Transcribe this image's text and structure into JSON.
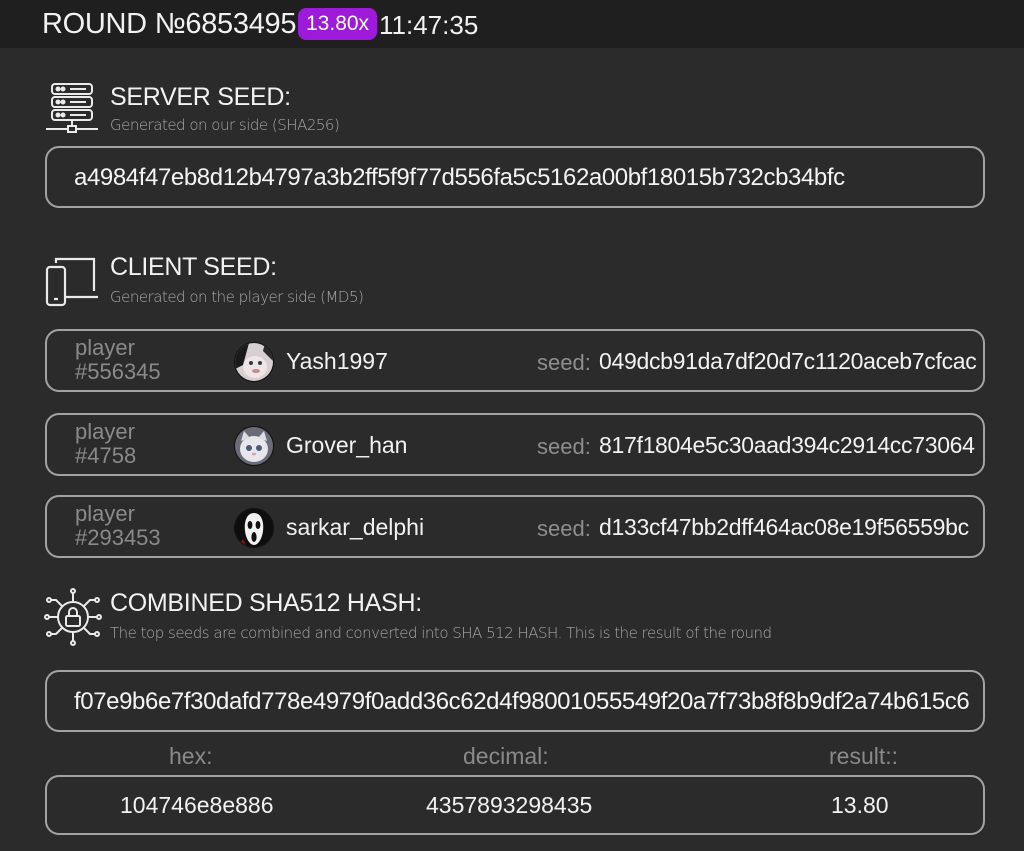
{
  "header": {
    "round_label": "ROUND №6853495",
    "multiplier": "13.80x",
    "time": "11:47:35",
    "multiplier_color": "#9d1bd8"
  },
  "server_seed": {
    "title": "SERVER SEED:",
    "subtitle": "Generated on our side (SHA256)",
    "icon": "server-icon",
    "value": "a4984f47eb8d12b4797a3b2ff5f9f77d556fa5c5162a00bf18015b732cb34bfc"
  },
  "client_seed": {
    "title": "CLIENT SEED:",
    "subtitle": "Generated on the player side (MD5)",
    "icon": "devices-icon",
    "players": [
      {
        "label": "player",
        "number": "#556345",
        "name": "Yash1997",
        "seed_label": "seed:",
        "seed": "049dcb91da7df20d7c1120aceb7cfcac"
      },
      {
        "label": "player",
        "number": "#4758",
        "name": "Grover_han",
        "seed_label": "seed:",
        "seed": "817f1804e5c30aad394c2914cc73064"
      },
      {
        "label": "player",
        "number": "#293453",
        "name": "sarkar_delphi",
        "seed_label": "seed:",
        "seed": "d133cf47bb2dff464ac08e19f56559bc"
      }
    ]
  },
  "combined": {
    "title": "COMBINED SHA512 HASH:",
    "subtitle": "The top seeds are combined and converted into SHA 512 HASH. This is the result of the round",
    "icon": "lock-circuit-icon",
    "value": "f07e9b6e7f30dafd778e4979f0add36c62d4f98001055549f20a7f73b8f8b9df2a74b615c6"
  },
  "result": {
    "hex_label": "hex:",
    "decimal_label": "decimal:",
    "result_label": "result::",
    "hex": "104746e8e886",
    "decimal": "4357893298435",
    "result": "13.80"
  }
}
